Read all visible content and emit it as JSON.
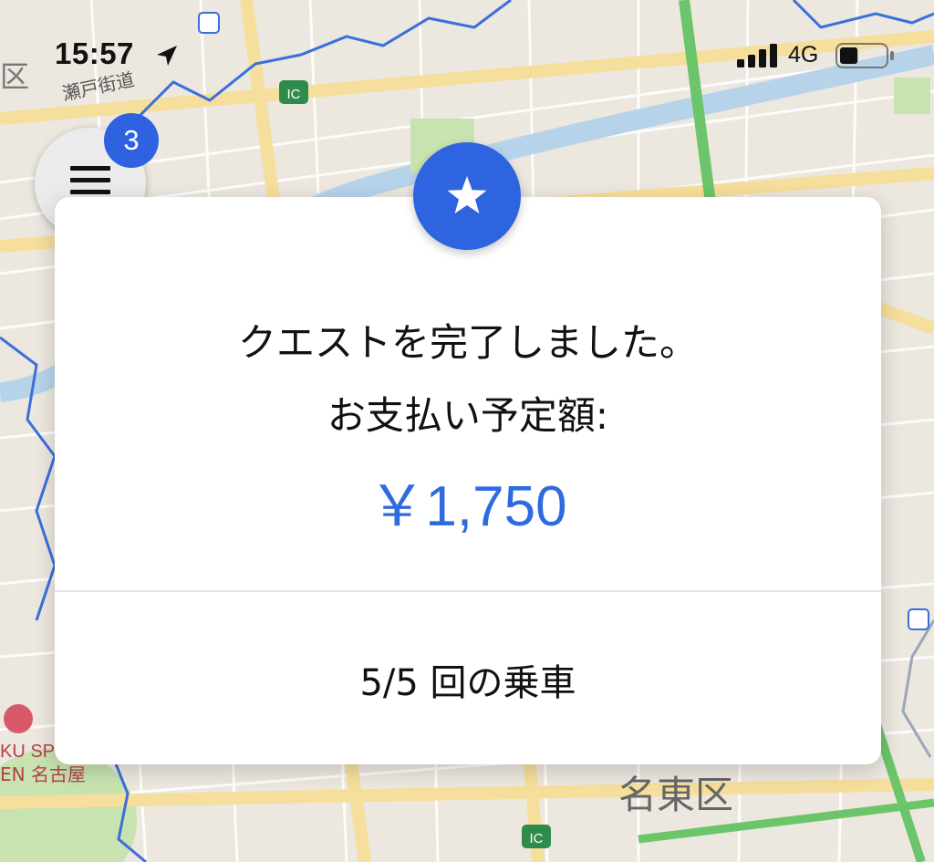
{
  "status_bar": {
    "time": "15:57",
    "network": "4G",
    "battery_level": 0.4,
    "signal_bars": 4
  },
  "map": {
    "labels": {
      "road": "瀬戸街道",
      "ic_1": "IC",
      "ic_2": "IC",
      "district": "名東区",
      "park_line1": "KU SP",
      "park_line2": "EN 名古屋",
      "edge_ward": "区"
    },
    "colors": {
      "background": "#ece7df",
      "road_major": "#f6df9c",
      "road_minor": "#ffffff",
      "expressway": "#6cc56b",
      "boundary": "#3a6fdc",
      "river": "#b7d3ea",
      "park": "#c8e2b0"
    }
  },
  "menu": {
    "badge_count": "3",
    "icon": "hamburger-icon"
  },
  "quest_card": {
    "icon": "star-icon",
    "message_line1": "クエストを完了しました。",
    "message_line2": "お支払い予定額:",
    "amount": "￥1,750",
    "rides_progress": "5/5 回の乗車",
    "accent_color": "#2f64e0"
  }
}
